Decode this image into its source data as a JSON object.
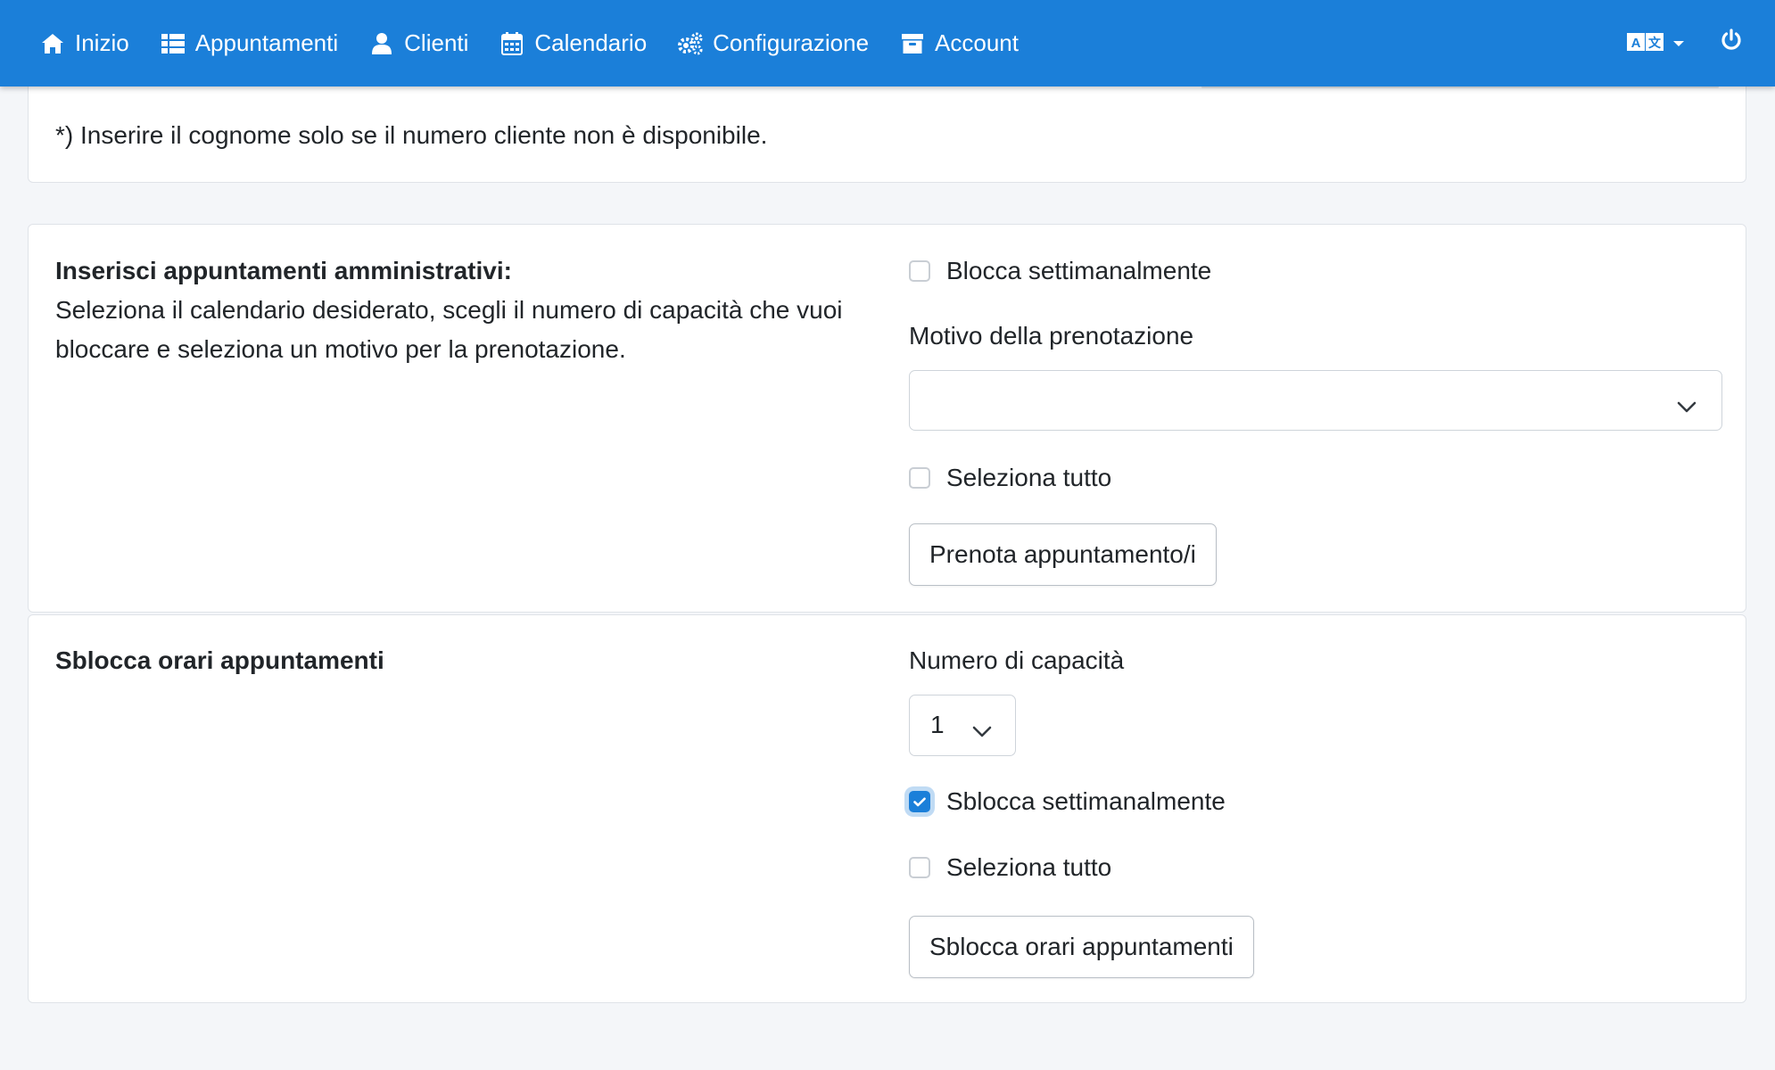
{
  "navbar": {
    "items": [
      {
        "label": "Inizio",
        "icon": "home-icon"
      },
      {
        "label": "Appuntamenti",
        "icon": "list-icon"
      },
      {
        "label": "Clienti",
        "icon": "user-icon"
      },
      {
        "label": "Calendario",
        "icon": "calendar-icon"
      },
      {
        "label": "Configurazione",
        "icon": "gears-icon"
      },
      {
        "label": "Account",
        "icon": "archive-icon"
      }
    ],
    "language_icon": "language-icon",
    "power_icon": "power-icon"
  },
  "top_card": {
    "note": "*) Inserire il cognome solo se il numero cliente non è disponibile."
  },
  "admin_card": {
    "title": "Inserisci appuntamenti amministrativi:",
    "description": "Seleziona il calendario desiderato, scegli il numero di capacità che vuoi bloccare e seleziona un motivo per la prenotazione.",
    "block_weekly_label": "Blocca settimanalmente",
    "block_weekly_checked": false,
    "reason_label": "Motivo della prenotazione",
    "reason_value": "",
    "select_all_label": "Seleziona tutto",
    "select_all_checked": false,
    "book_button": "Prenota appuntamento/i"
  },
  "unblock_card": {
    "title": "Sblocca orari appuntamenti",
    "capacity_label": "Numero di capacità",
    "capacity_value": "1",
    "unblock_weekly_label": "Sblocca settimanalmente",
    "unblock_weekly_checked": true,
    "select_all_label": "Seleziona tutto",
    "select_all_checked": false,
    "unblock_button": "Sblocca orari appuntamenti"
  },
  "colors": {
    "navbar": "#1b7fd9",
    "background": "#f4f6f9",
    "accent": "#1b7fd9"
  }
}
